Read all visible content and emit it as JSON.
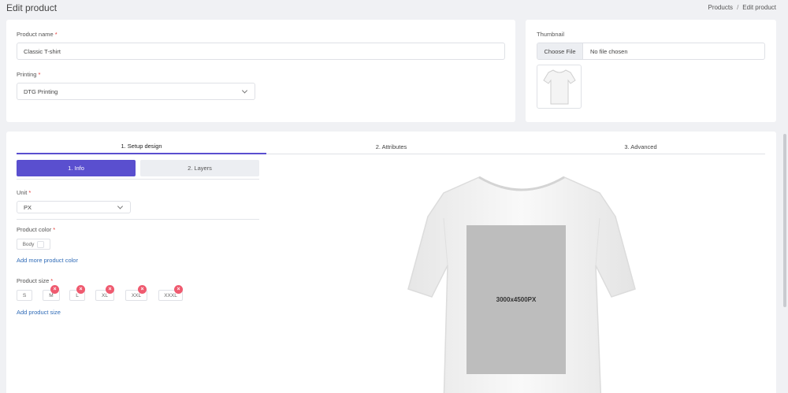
{
  "page": {
    "title": "Edit product",
    "breadcrumb": [
      "Products",
      "Edit product"
    ],
    "breadcrumb_sep": "/"
  },
  "product_form": {
    "name_label": "Product name",
    "name_value": "Classic T-shirt",
    "printing_label": "Printing",
    "printing_value": "DTG Printing",
    "required_mark": "*"
  },
  "thumbnail": {
    "label": "Thumbnail",
    "choose_file": "Choose File",
    "no_file": "No file chosen"
  },
  "tabs": [
    "1. Setup design",
    "2. Attributes",
    "3. Advanced"
  ],
  "subtabs": [
    "1. Info",
    "2. Layers"
  ],
  "unit": {
    "label": "Unit",
    "value": "PX"
  },
  "product_color": {
    "label": "Product color",
    "chip": "Body",
    "add_link": "Add more product color"
  },
  "product_size": {
    "label": "Product size",
    "sizes": [
      "S",
      "M",
      "L",
      "XL",
      "XXL",
      "XXXL"
    ],
    "remove_icon": "×",
    "add_link": "Add product size"
  },
  "preview": {
    "print_area_label": "3000x4500PX"
  },
  "colors": {
    "accent": "#5a4fcf",
    "link": "#2f6bb7",
    "remove": "#ef5a6f"
  }
}
